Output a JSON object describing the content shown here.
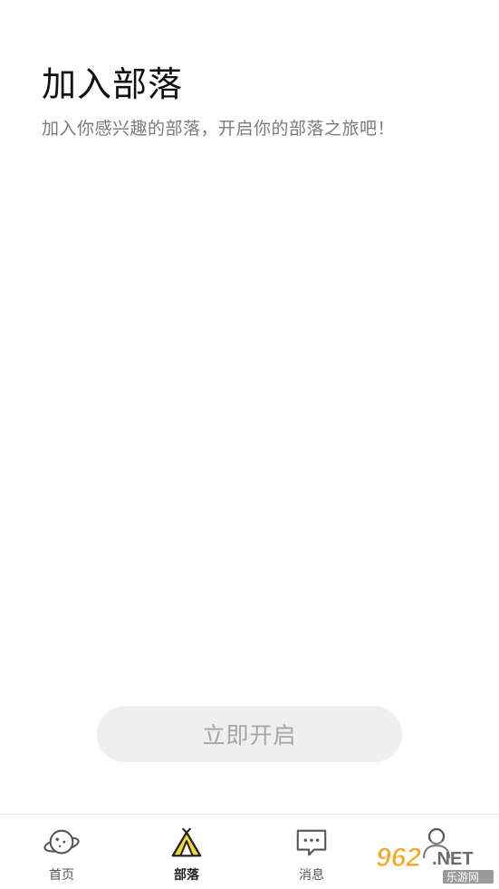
{
  "header": {
    "title": "加入部落",
    "subtitle": "加入你感兴趣的部落，开启你的部落之旅吧！"
  },
  "action": {
    "start_label": "立即开启"
  },
  "tabbar": {
    "tabs": [
      {
        "label": "首页",
        "icon": "planet-icon",
        "active": false
      },
      {
        "label": "部落",
        "icon": "tent-icon",
        "active": true
      },
      {
        "label": "消息",
        "icon": "chat-bubble-icon",
        "active": false
      },
      {
        "label": "",
        "icon": "profile-icon",
        "active": false
      }
    ]
  },
  "watermark": {
    "text": "962.NET",
    "subtext": "乐游网"
  },
  "colors": {
    "accent_yellow": "#f7d23a",
    "button_bg": "#efefef",
    "button_text": "#a6a6a6",
    "subtitle_text": "#7a7a7a"
  }
}
